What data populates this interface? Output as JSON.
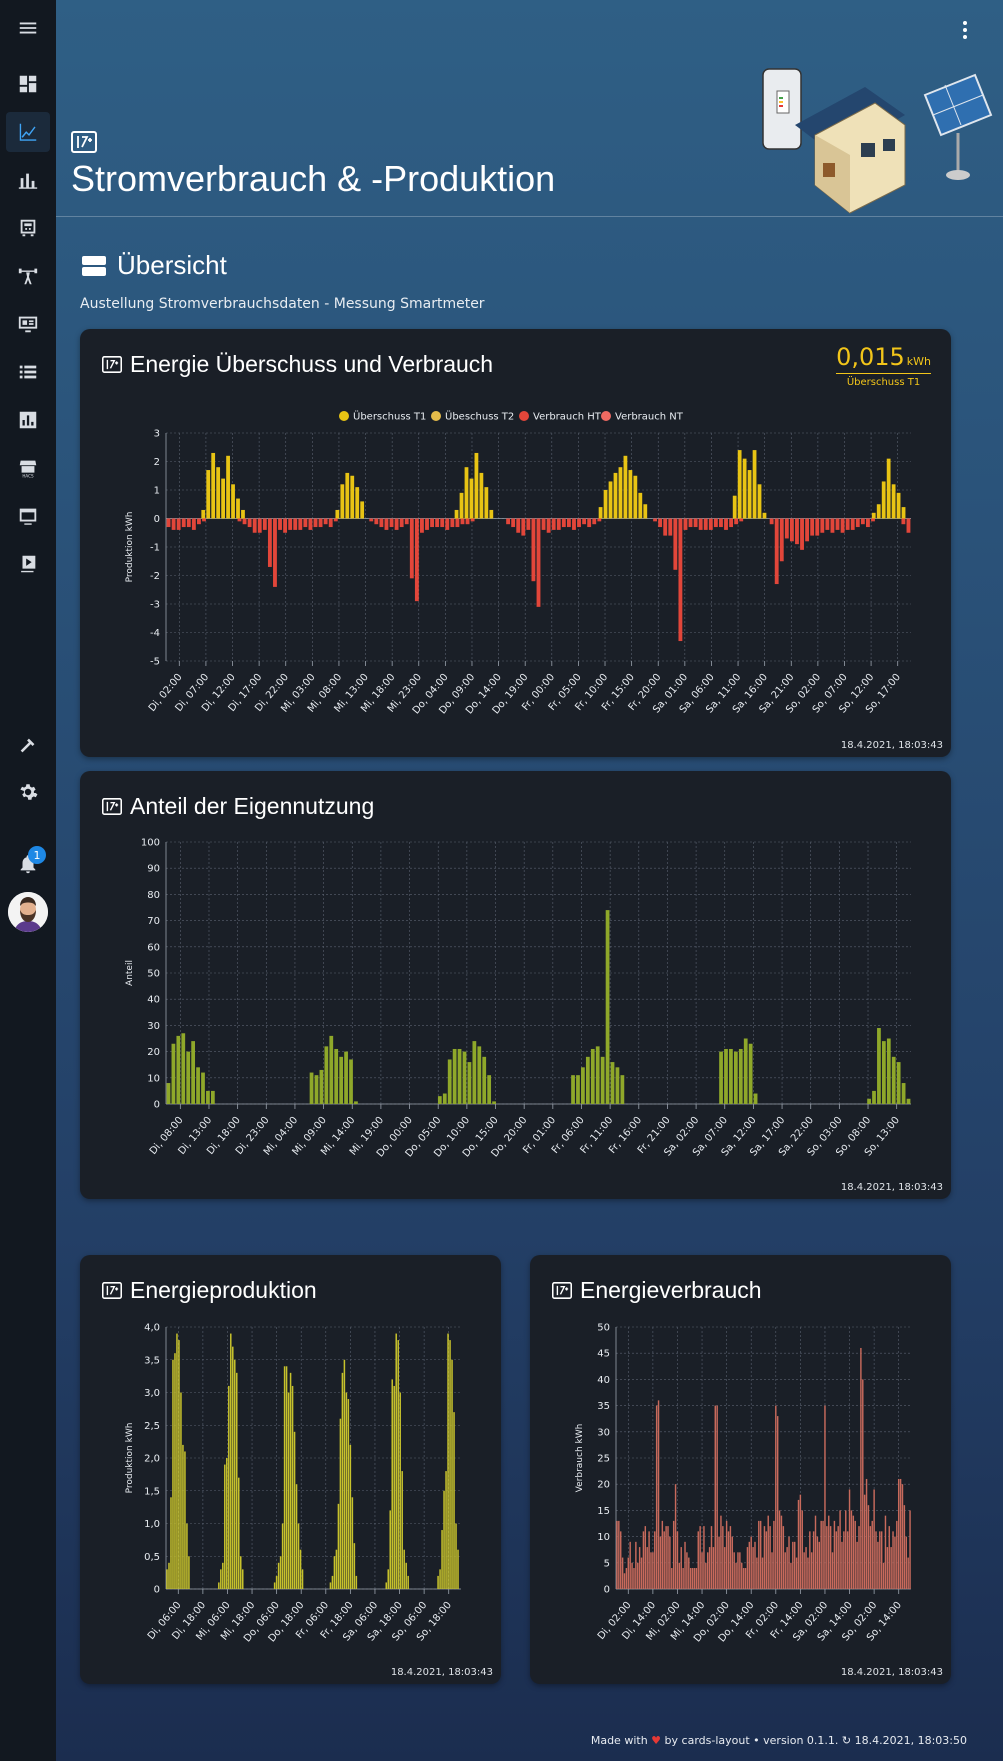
{
  "page": {
    "title": "Stromverbrauch & -Produktion",
    "section_title": "Übersicht",
    "section_subtitle": "Austellung Stromverbrauchsdaten - Messung Smartmeter"
  },
  "sidebar": {
    "notification_count": "1",
    "icons": [
      "menu-icon",
      "dashboard-icon",
      "chart-line-icon",
      "bar-chart-icon",
      "solar-inverter-icon",
      "weightlifting-icon",
      "monitor-icon",
      "list-icon",
      "poll-icon",
      "hacs-icon",
      "window-icon",
      "playlist-play-icon",
      "hammer-icon",
      "gear-icon",
      "bell-icon"
    ]
  },
  "cards": {
    "energie": {
      "title": "Energie Überschuss und Verbrauch",
      "stat_value": "0,015",
      "stat_unit": "kWh",
      "stat_label": "Überschuss T1",
      "timestamp": "18.4.2021, 18:03:43"
    },
    "anteil": {
      "title": "Anteil der Eigennutzung",
      "timestamp": "18.4.2021, 18:03:43"
    },
    "produktion": {
      "title": "Energieproduktion",
      "timestamp": "18.4.2021, 18:03:43"
    },
    "verbrauch": {
      "title": "Energieverbrauch",
      "timestamp": "18.4.2021, 18:03:43"
    }
  },
  "footer": {
    "prefix": "Made with",
    "suffix": "by cards-layout • version 0.1.1. ↻ 18.4.2021, 18:03:50"
  },
  "colors": {
    "ueberschuss_t1": "#e8c414",
    "ueberschuss_t2": "#e6bc4a",
    "verbrauch_ht": "#e2463a",
    "verbrauch_nt": "#ef6a62",
    "anteil": "#8fa82a",
    "produktion": "#c7c22c",
    "verbrauch": "#c86a5c"
  },
  "chart_data": [
    {
      "id": "energie",
      "type": "bar",
      "ylabel": "Produktion kWh",
      "ylim": [
        -5,
        3
      ],
      "yticks": [
        3,
        2,
        1,
        0,
        -1,
        -2,
        -3,
        -4,
        -5
      ],
      "grid": true,
      "legend_position": "top",
      "xticks": [
        "Di, 02:00",
        "Di, 07:00",
        "Di, 12:00",
        "Di, 17:00",
        "Di, 22:00",
        "Mi, 03:00",
        "Mi, 08:00",
        "Mi, 13:00",
        "Mi, 18:00",
        "Mi, 23:00",
        "Do, 04:00",
        "Do, 09:00",
        "Do, 14:00",
        "Do, 19:00",
        "Fr, 00:00",
        "Fr, 05:00",
        "Fr, 10:00",
        "Fr, 15:00",
        "Fr, 20:00",
        "Sa, 01:00",
        "Sa, 06:00",
        "Sa, 11:00",
        "Sa, 16:00",
        "Sa, 21:00",
        "So, 02:00",
        "So, 07:00",
        "So, 12:00",
        "So, 17:00"
      ],
      "series": [
        {
          "name": "Überschuss T1",
          "values": [
            0,
            0,
            0,
            0,
            0,
            0,
            0,
            0.3,
            1.7,
            2.3,
            1.8,
            1.4,
            2.2,
            1.2,
            0.7,
            0.3,
            0,
            0,
            0,
            0,
            0,
            0,
            0,
            0,
            0,
            0,
            0,
            0,
            0,
            0,
            0,
            0,
            0,
            0,
            0.3,
            1.2,
            1.6,
            1.5,
            1.1,
            0.6,
            0,
            0,
            0,
            0,
            0,
            0,
            0,
            0,
            0,
            0,
            0,
            0,
            0,
            0,
            0,
            0,
            0,
            0,
            0.3,
            0.9,
            1.8,
            1.4,
            2.3,
            1.6,
            1.1,
            0.3,
            0,
            0,
            0,
            0,
            0,
            0,
            0,
            0,
            0,
            0,
            0,
            0,
            0,
            0,
            0,
            0,
            0,
            0,
            0,
            0,
            0,
            0.4,
            1.0,
            1.3,
            1.6,
            1.8,
            2.2,
            1.7,
            1.5,
            0.9,
            0.5,
            0,
            0,
            0,
            0,
            0,
            0,
            0,
            0,
            0,
            0,
            0,
            0,
            0,
            0,
            0,
            0,
            0,
            0.8,
            2.4,
            2.1,
            1.7,
            2.4,
            1.2,
            0.2,
            0,
            0,
            0,
            0,
            0,
            0,
            0,
            0,
            0,
            0,
            0,
            0,
            0,
            0,
            0,
            0,
            0,
            0,
            0,
            0,
            0,
            0.2,
            0.5,
            1.3,
            2.1,
            1.2,
            0.9,
            0.4,
            0
          ]
        },
        {
          "name": "Übeschuss T2",
          "values": []
        },
        {
          "name": "Verbrauch HT",
          "values": [
            -0.3,
            -0.4,
            -0.4,
            -0.3,
            -0.3,
            -0.4,
            -0.2,
            -0.1,
            0,
            0,
            0,
            0,
            0,
            0,
            -0.1,
            -0.2,
            -0.3,
            -0.5,
            -0.5,
            -0.4,
            -1.7,
            -2.4,
            -0.4,
            -0.5,
            -0.4,
            -0.4,
            -0.4,
            -0.3,
            -0.4,
            -0.3,
            -0.3,
            -0.2,
            -0.3,
            -0.1,
            0,
            0,
            0,
            0,
            0,
            0,
            -0.1,
            -0.2,
            -0.3,
            -0.4,
            -0.3,
            -0.4,
            -0.3,
            -0.2,
            -2.1,
            -2.9,
            -0.5,
            -0.4,
            -0.3,
            -0.3,
            -0.3,
            -0.4,
            -0.3,
            -0.3,
            -0.2,
            -0.2,
            -0.1,
            0,
            0,
            0,
            0,
            0,
            0,
            -0.2,
            -0.3,
            -0.5,
            -0.6,
            -0.4,
            -2.2,
            -3.1,
            -0.4,
            -0.5,
            -0.4,
            -0.4,
            -0.3,
            -0.3,
            -0.4,
            -0.3,
            -0.2,
            -0.3,
            -0.2,
            -0.1,
            0,
            0,
            0,
            0,
            0,
            0,
            0,
            0,
            0,
            0,
            -0.1,
            -0.3,
            -0.6,
            -0.6,
            -1.8,
            -4.3,
            -0.4,
            -0.3,
            -0.3,
            -0.4,
            -0.4,
            -0.4,
            -0.3,
            -0.3,
            -0.4,
            -0.3,
            -0.2,
            -0.1,
            0,
            0,
            0,
            0,
            0,
            -0.2,
            -2.3,
            -1.5,
            -0.7,
            -0.8,
            -0.9,
            -1.1,
            -0.8,
            -0.6,
            -0.6,
            -0.5,
            -0.4,
            -0.5,
            -0.4,
            -0.5,
            -0.4,
            -0.4,
            -0.3,
            -0.2,
            -0.3,
            -0.1,
            0,
            0,
            0,
            0,
            0,
            -0.2,
            -0.5
          ]
        },
        {
          "name": "Verbrauch NT",
          "values": []
        }
      ]
    },
    {
      "id": "anteil",
      "type": "bar",
      "ylabel": "Anteil",
      "ylim": [
        0,
        100
      ],
      "yticks": [
        100,
        90,
        80,
        70,
        60,
        50,
        40,
        30,
        20,
        10,
        0
      ],
      "grid": true,
      "xticks": [
        "Di, 08:00",
        "Di, 13:00",
        "Di, 18:00",
        "Di, 23:00",
        "Mi, 04:00",
        "Mi, 09:00",
        "Mi, 14:00",
        "Mi, 19:00",
        "Do, 00:00",
        "Do, 05:00",
        "Do, 10:00",
        "Do, 15:00",
        "Do, 20:00",
        "Fr, 01:00",
        "Fr, 06:00",
        "Fr, 11:00",
        "Fr, 16:00",
        "Fr, 21:00",
        "Sa, 02:00",
        "Sa, 07:00",
        "Sa, 12:00",
        "Sa, 17:00",
        "Sa, 22:00",
        "So, 03:00",
        "So, 08:00",
        "So, 13:00"
      ],
      "series": [
        {
          "name": "",
          "values": [
            8,
            23,
            26,
            27,
            20,
            24,
            14,
            12,
            5,
            5,
            0,
            0,
            0,
            0,
            0,
            0,
            0,
            0,
            0,
            0,
            0,
            0,
            0,
            0,
            0,
            0,
            0,
            0,
            0,
            12,
            11,
            13,
            22,
            26,
            21,
            18,
            20,
            17,
            1,
            0,
            0,
            0,
            0,
            0,
            0,
            0,
            0,
            0,
            0,
            0,
            0,
            0,
            0,
            0,
            0,
            3,
            4,
            17,
            21,
            21,
            20,
            16,
            24,
            22,
            18,
            11,
            1,
            0,
            0,
            0,
            0,
            0,
            0,
            0,
            0,
            0,
            0,
            0,
            0,
            0,
            0,
            0,
            11,
            11,
            14,
            18,
            21,
            22,
            18,
            74,
            16,
            14,
            11,
            0,
            0,
            0,
            0,
            0,
            0,
            0,
            0,
            0,
            0,
            0,
            0,
            0,
            0,
            0,
            0,
            0,
            0,
            0,
            20,
            21,
            21,
            20,
            21,
            25,
            23,
            4,
            0,
            0,
            0,
            0,
            0,
            0,
            0,
            0,
            0,
            0,
            0,
            0,
            0,
            0,
            0,
            0,
            0,
            0,
            0,
            0,
            0,
            0,
            2,
            5,
            29,
            24,
            25,
            18,
            16,
            8,
            2
          ]
        }
      ]
    },
    {
      "id": "produktion",
      "type": "bar",
      "ylabel": "Produktion kWh",
      "ylim": [
        0,
        4.0
      ],
      "yticks": [
        "4,0",
        "3,5",
        "3,0",
        "2,5",
        "2,0",
        "1,5",
        "1,0",
        "0,5",
        "0"
      ],
      "grid": true,
      "xticks": [
        "Di, 06:00",
        "Di, 18:00",
        "Mi, 06:00",
        "Mi, 18:00",
        "Do, 06:00",
        "Do, 18:00",
        "Fr, 06:00",
        "Fr, 18:00",
        "Sa, 06:00",
        "Sa, 18:00",
        "So, 06:00",
        "So, 18:00"
      ],
      "series": [
        {
          "name": "",
          "values": [
            0.3,
            0.4,
            1.4,
            3.5,
            3.6,
            3.9,
            3.8,
            3.0,
            2.2,
            2.1,
            1.0,
            0.5,
            0,
            0,
            0,
            0,
            0,
            0,
            0,
            0,
            0,
            0,
            0,
            0,
            0,
            0,
            0.1,
            0.3,
            0.4,
            1.9,
            2.0,
            3.1,
            3.9,
            3.7,
            3.5,
            3.3,
            1.7,
            0.5,
            0.3,
            0,
            0,
            0,
            0,
            0,
            0,
            0,
            0,
            0,
            0,
            0,
            0,
            0,
            0,
            0,
            0.1,
            0.2,
            0.4,
            0.5,
            1.0,
            3.4,
            3.4,
            3.0,
            3.3,
            3.1,
            2.4,
            1.6,
            1.0,
            0.6,
            0.3,
            0,
            0,
            0,
            0,
            0,
            0,
            0,
            0,
            0,
            0,
            0,
            0,
            0,
            0.1,
            0.2,
            0.5,
            0.6,
            1.3,
            2.6,
            3.3,
            3.5,
            3.0,
            2.9,
            2.2,
            1.4,
            0.7,
            0.2,
            0,
            0,
            0,
            0,
            0,
            0,
            0,
            0,
            0,
            0,
            0,
            0,
            0,
            0,
            0.1,
            0.3,
            1.2,
            3.2,
            3.1,
            3.9,
            3.8,
            3.0,
            1.8,
            0.6,
            0.4,
            0.2,
            0,
            0,
            0,
            0,
            0,
            0,
            0,
            0,
            0,
            0,
            0,
            0,
            0,
            0,
            0.2,
            0.3,
            0.9,
            1.5,
            1.8,
            3.9,
            3.8,
            3.5,
            2.7,
            1.0,
            0.6,
            0
          ]
        }
      ]
    },
    {
      "id": "verbrauch",
      "type": "bar",
      "ylabel": "Verbrauch kWh",
      "ylim": [
        0,
        50
      ],
      "yticks": [
        50,
        45,
        40,
        35,
        30,
        25,
        20,
        15,
        10,
        5,
        0
      ],
      "grid": true,
      "xticks": [
        "Di, 02:00",
        "Di, 14:00",
        "Mi, 02:00",
        "Mi, 14:00",
        "Do, 02:00",
        "Do, 14:00",
        "Fr, 02:00",
        "Fr, 14:00",
        "Sa, 02:00",
        "Sa, 14:00",
        "So, 02:00",
        "So, 14:00"
      ],
      "series": [
        {
          "name": "",
          "values": [
            13,
            13,
            11,
            6,
            3,
            4,
            6,
            9,
            5,
            4,
            9,
            5,
            8,
            6,
            11,
            12,
            8,
            11,
            7,
            7,
            11,
            35,
            36,
            10,
            13,
            11,
            12,
            12,
            10,
            4,
            13,
            20,
            11,
            5,
            8,
            4,
            9,
            7,
            6,
            4,
            4,
            4,
            4,
            11,
            12,
            7,
            12,
            5,
            7,
            8,
            12,
            8,
            35,
            35,
            10,
            14,
            12,
            8,
            13,
            11,
            12,
            10,
            7,
            5,
            7,
            7,
            5,
            4,
            4,
            8,
            9,
            10,
            8,
            9,
            6,
            13,
            13,
            6,
            12,
            11,
            14,
            12,
            7,
            13,
            35,
            33,
            15,
            14,
            12,
            7,
            8,
            10,
            5,
            9,
            9,
            6,
            17,
            18,
            15,
            7,
            8,
            6,
            11,
            7,
            11,
            14,
            10,
            9,
            13,
            13,
            35,
            12,
            14,
            12,
            7,
            13,
            11,
            12,
            15,
            9,
            11,
            15,
            11,
            19,
            15,
            14,
            13,
            9,
            12,
            46,
            40,
            18,
            21,
            16,
            12,
            13,
            19,
            11,
            9,
            11,
            11,
            5,
            14,
            8,
            12,
            8,
            11,
            10,
            13,
            21,
            21,
            20,
            16,
            10,
            6,
            15
          ]
        }
      ]
    }
  ]
}
